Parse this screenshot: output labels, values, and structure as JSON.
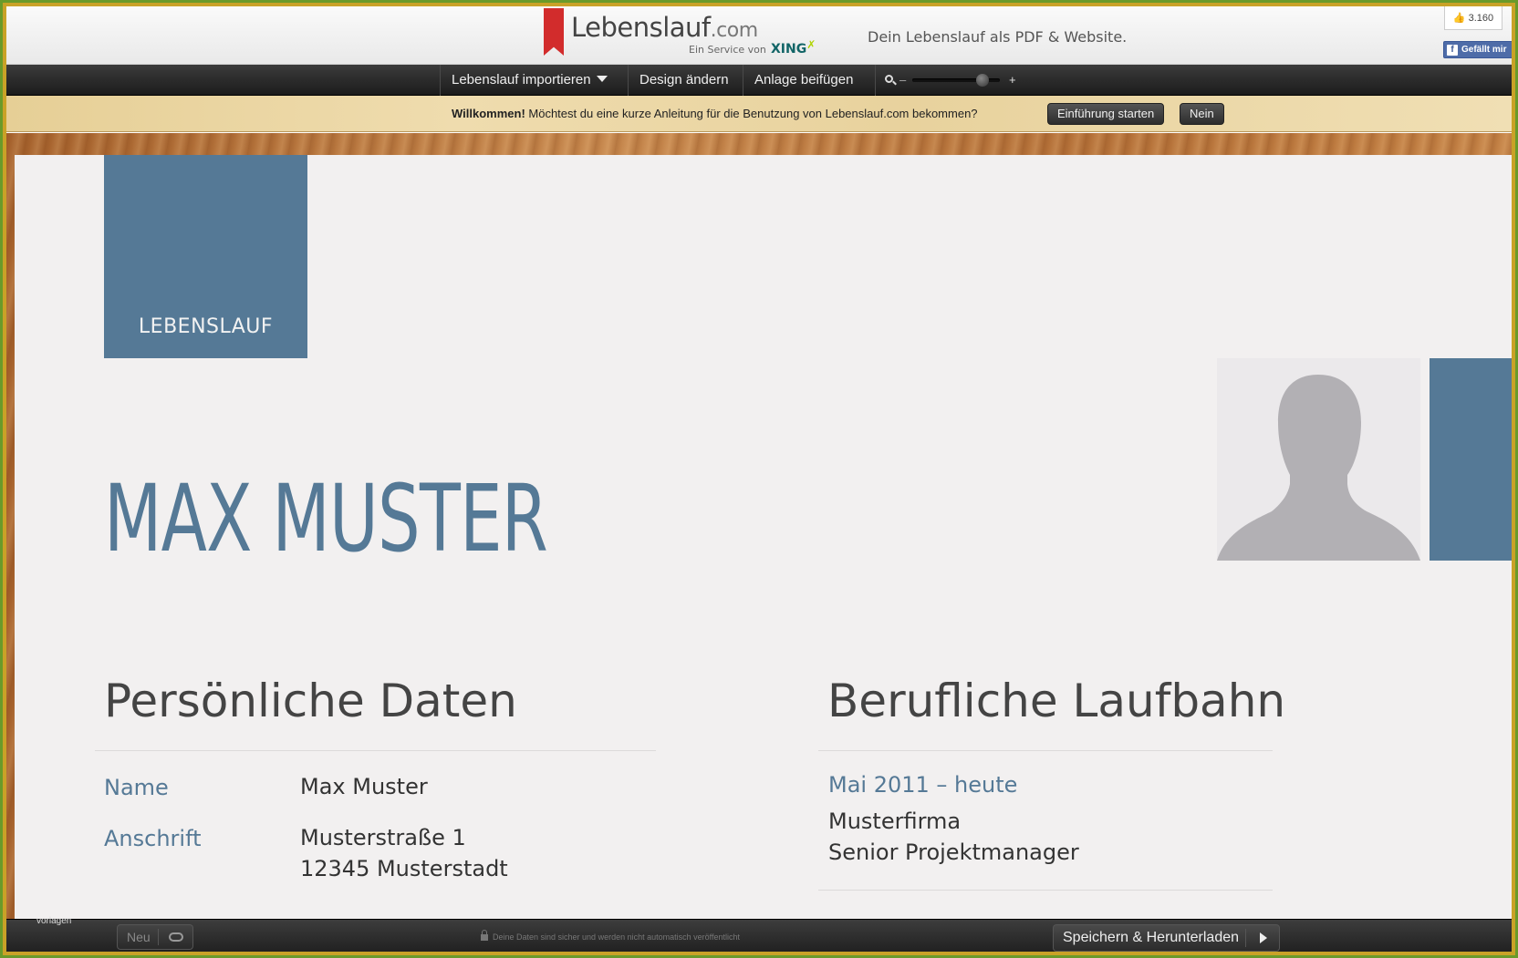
{
  "header": {
    "logo_text": "Lebenslauf",
    "logo_suffix": ".com",
    "logo_sub": "Ein Service von",
    "logo_brand": "XING",
    "tagline": "Dein Lebenslauf als PDF & Website.",
    "like_count": "3.160",
    "like_button": "Gefällt mir"
  },
  "nav": {
    "items": [
      {
        "label": "Lebenslauf importieren"
      },
      {
        "label": "Design ändern"
      },
      {
        "label": "Anlage beifügen"
      }
    ],
    "zoom_minus": "–",
    "zoom_plus": "+",
    "zoom_level": 0.85
  },
  "welcome": {
    "bold": "Willkommen!",
    "text": " Möchtest du eine kurze Anleitung für die Benutzung von Lebenslauf.com bekommen?",
    "start_button": "Einführung starten",
    "no_button": "Nein"
  },
  "resume": {
    "title_label": "LEBENSLAUF",
    "name": "MAX MUSTER",
    "personal": {
      "heading": "Persönliche Daten",
      "rows": [
        {
          "label": "Name",
          "value": "Max Muster"
        },
        {
          "label": "Anschrift",
          "value": "Musterstraße 1",
          "value2": "12345 Musterstadt"
        }
      ]
    },
    "career": {
      "heading": "Berufliche Laufbahn",
      "entries": [
        {
          "period": "Mai 2011 – heute",
          "company": "Musterfirma",
          "role": "Senior Projektmanager"
        }
      ]
    }
  },
  "footer": {
    "vorlagen": "vorlagen",
    "new_button": "Neu",
    "secure_note": "Deine Daten sind sicher und werden nicht automatisch veröffentlicht",
    "save_button": "Speichern & Herunterladen"
  },
  "colors": {
    "accent": "#557996",
    "frame": "#c9a227"
  }
}
